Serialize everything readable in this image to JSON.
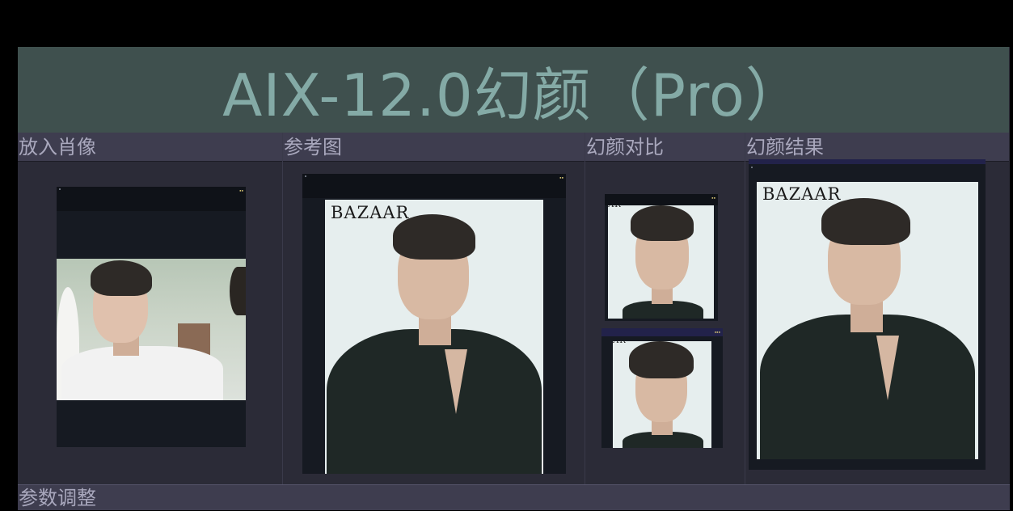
{
  "app": {
    "title": "AIX-12.0幻颜（Pro）"
  },
  "panels": {
    "source": {
      "label": "放入肖像"
    },
    "reference": {
      "label": "参考图"
    },
    "compare": {
      "label": "幻颜对比"
    },
    "result": {
      "label": "幻颜结果"
    }
  },
  "images": {
    "reference_brand": "BAZAAR",
    "result_brand": "BAZAAR",
    "compare_top_brand": "AR",
    "compare_bottom_brand": "AR"
  },
  "footer": {
    "label": "参数调整"
  },
  "colors": {
    "title_bg": "#3f504e",
    "title_text": "#84aaa6",
    "panel_header_bg": "#3e3d4f",
    "panel_header_text": "#a9a8bd",
    "panel_bg": "#2b2b37"
  }
}
